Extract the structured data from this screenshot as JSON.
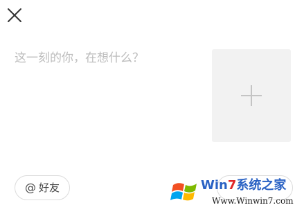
{
  "compose": {
    "placeholder": "这一刻的你，在想什么？",
    "value": ""
  },
  "toolbar": {
    "mention_label": "好友",
    "mention_icon": "at-icon",
    "close_icon": "close-icon"
  },
  "media": {
    "add_icon": "plus-icon"
  },
  "watermark": {
    "title_part1": "Win",
    "title_part2": "7",
    "title_part3": "系统之家",
    "url": "Www.Winwin7.com"
  },
  "colors": {
    "placeholder": "#bcbcbc",
    "tile_background": "#f2f2f2",
    "border": "#dcdcdc",
    "watermark_blue": "#2a62c4",
    "watermark_red": "#e0282a"
  }
}
